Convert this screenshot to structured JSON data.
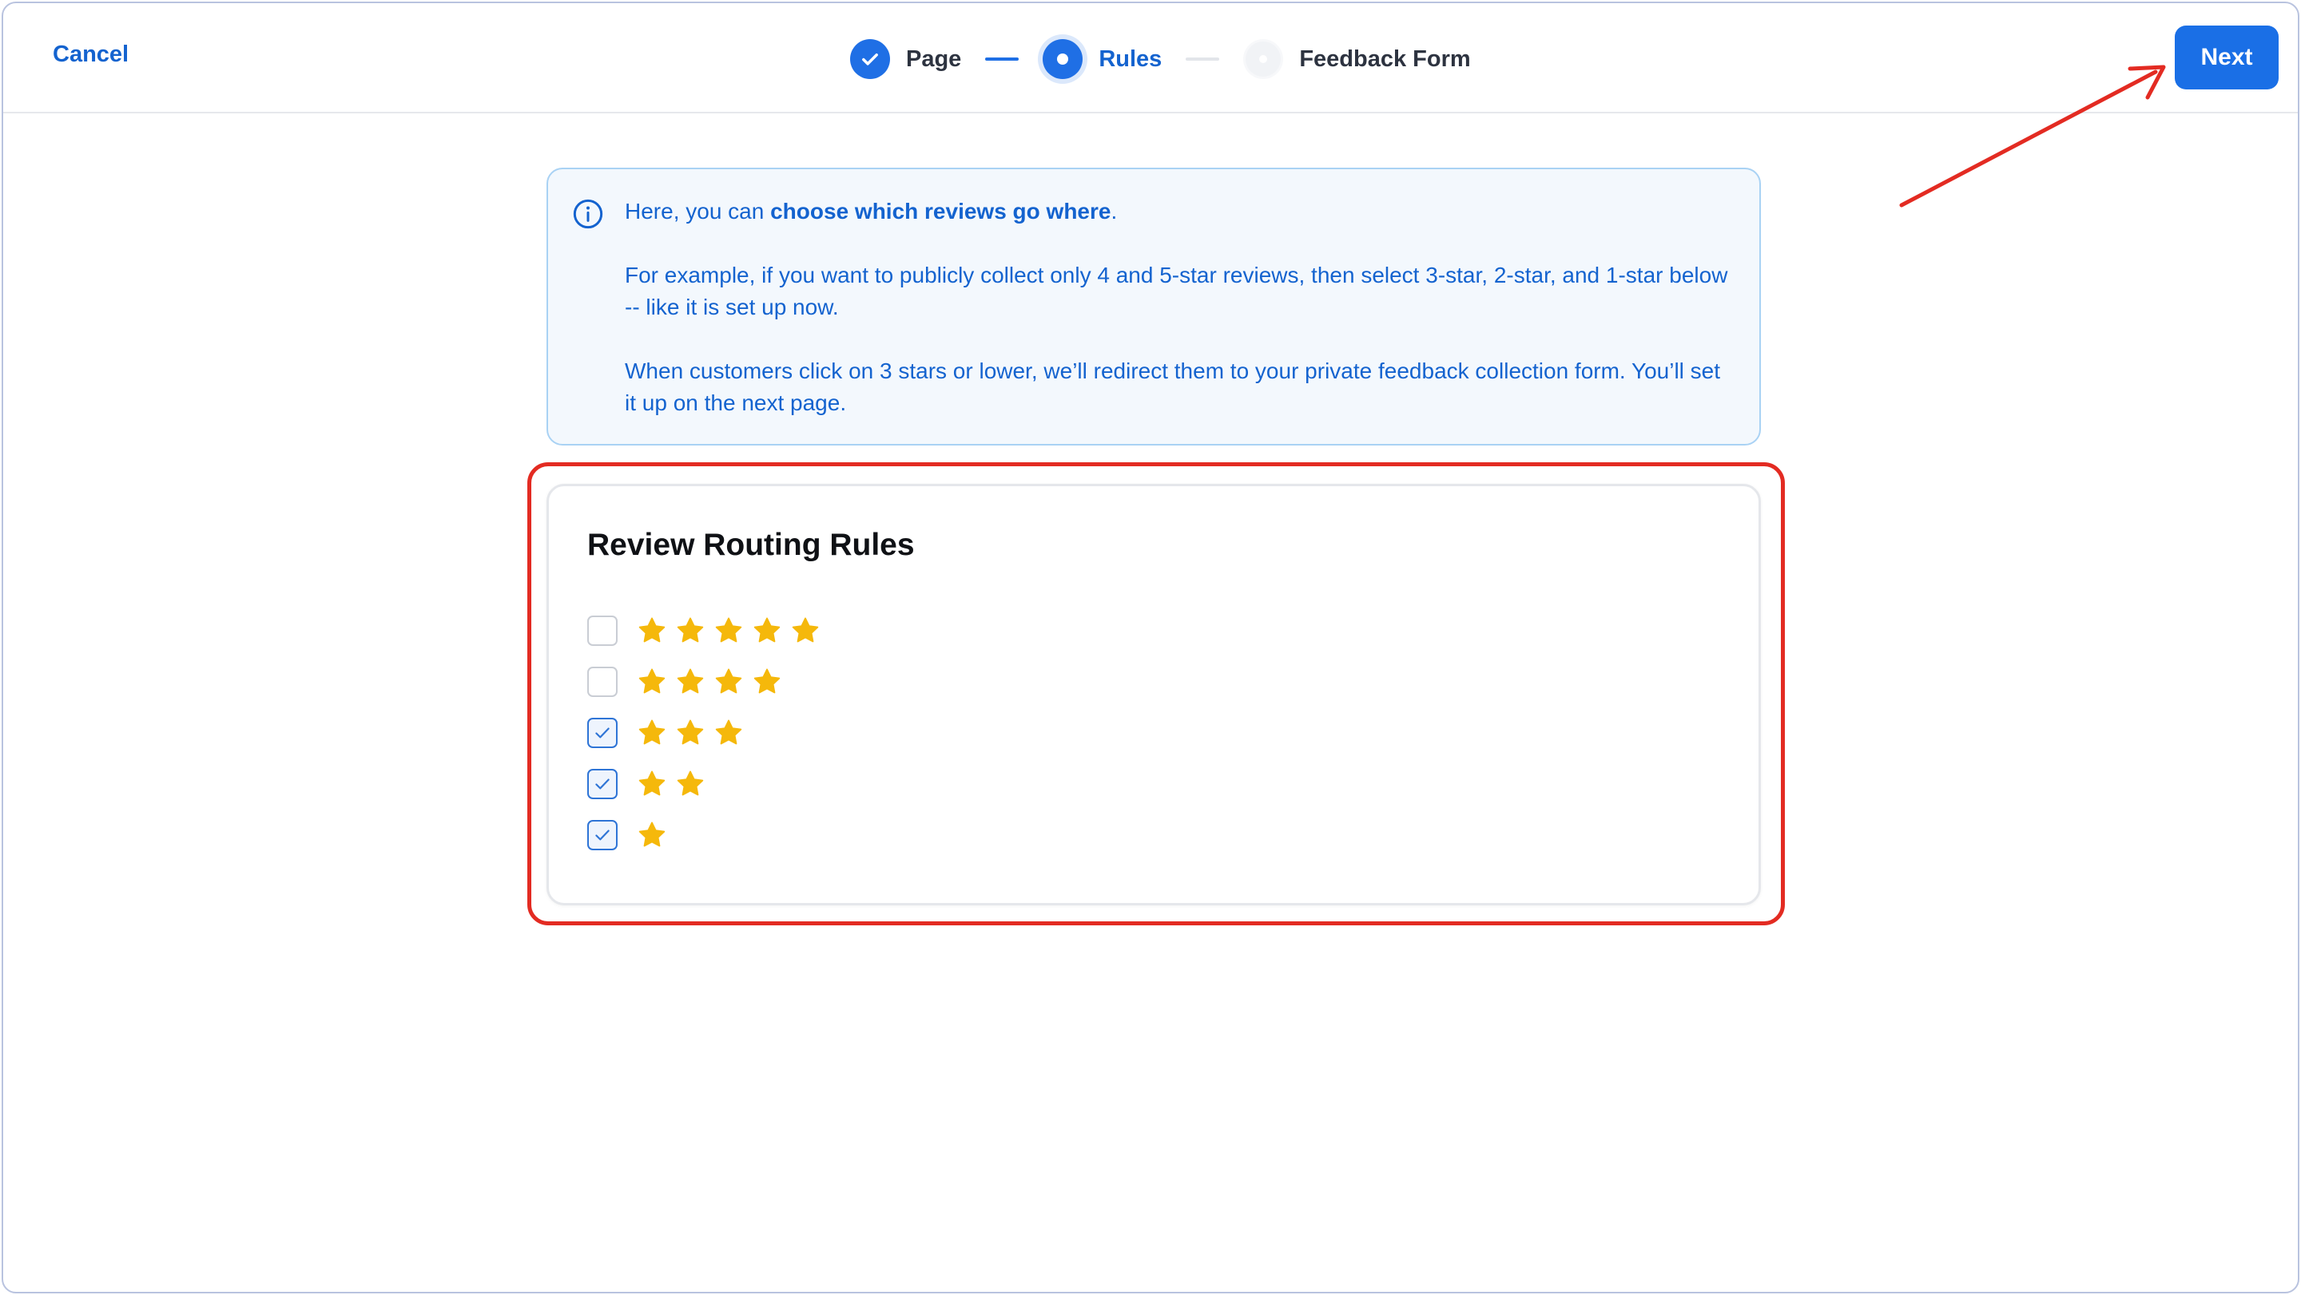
{
  "header": {
    "cancel_label": "Cancel",
    "next_label": "Next",
    "steps": [
      {
        "label": "Page",
        "state": "done"
      },
      {
        "label": "Rules",
        "state": "current"
      },
      {
        "label": "Feedback Form",
        "state": "upcoming"
      }
    ]
  },
  "info": {
    "line1_prefix": "Here, you can ",
    "line1_bold": "choose which reviews go where",
    "line1_suffix": ".",
    "paragraph2": "For example, if you want to publicly collect only 4 and 5-star reviews, then select 3-star, 2-star, and 1-star below -- like it is set up now.",
    "paragraph3": "When customers click on 3 stars or lower, we’ll redirect them to your private feedback collection form. You’ll set it up on the next page."
  },
  "rules": {
    "title": "Review Routing Rules",
    "options": [
      {
        "stars": 5,
        "checked": false
      },
      {
        "stars": 4,
        "checked": false
      },
      {
        "stars": 3,
        "checked": true
      },
      {
        "stars": 2,
        "checked": true
      },
      {
        "stars": 1,
        "checked": true
      }
    ]
  },
  "colors": {
    "primary": "#1a6fe6",
    "link": "#1463cf",
    "star": "#f5b80b",
    "annotation": "#e32b22",
    "info_bg": "#f3f8fd",
    "info_border": "#a9d2f4"
  },
  "icons": {
    "step_done": "check-icon",
    "info": "info-circle-icon",
    "star": "star-icon",
    "checkbox_checked": "checkmark-icon"
  }
}
